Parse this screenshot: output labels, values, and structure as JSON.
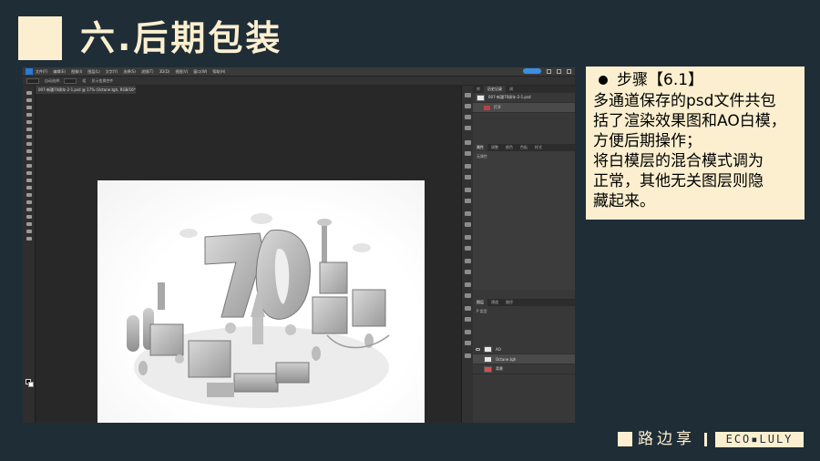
{
  "slide": {
    "title": "六.后期包装"
  },
  "photoshop": {
    "menu": [
      "文件(F)",
      "编辑(E)",
      "图像(I)",
      "图层(L)",
      "文字(Y)",
      "选择(S)",
      "滤镜(T)",
      "3D(D)",
      "视图(V)",
      "窗口(W)",
      "帮助(H)"
    ],
    "options": [
      "自动选择:",
      "组",
      "显示变换控件"
    ],
    "document_tab": "007-新疆70周年-2-1.psd @ 17% (Octane.tgh, RGB/16*)",
    "history_panel": {
      "tabs": [
        "库",
        "历史记录",
        "调"
      ],
      "rows": [
        "007-新疆70周年-2-1.psd",
        "打开"
      ]
    },
    "adjust_panel": {
      "tabs": [
        "属性",
        "调整",
        "颜色",
        "色板",
        "样式"
      ],
      "label": "无属性"
    },
    "layers_panel": {
      "tabs": [
        "图层",
        "通道",
        "路径"
      ],
      "filter_label": "P 类型",
      "rows": [
        "AO",
        "Octane.tgh",
        "背景"
      ]
    }
  },
  "info_box": {
    "step_title": "步骤【6.1】",
    "body": "多通道保存的psd文件共包\n括了渲染效果图和AO白模，\n方便后期操作；\n将白模层的混合模式调为\n正常，其他无关图层则隐\n藏起来。"
  },
  "footer": {
    "name": "路边享",
    "brand": "ECO▪LULY"
  },
  "colors": {
    "background": "#1f2d36",
    "accent": "#fbefcf"
  }
}
